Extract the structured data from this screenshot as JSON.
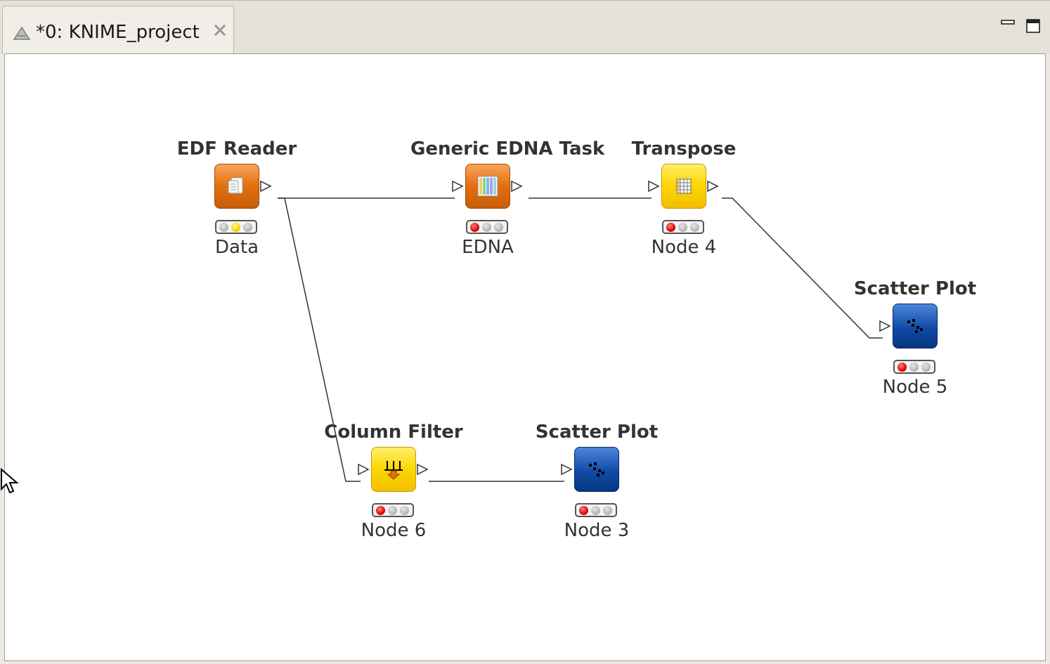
{
  "editor": {
    "tab_title": "*0: KNIME_project",
    "tab_icon": "workflow-icon",
    "close_icon": "close-icon",
    "minimize_icon": "minimize-icon",
    "maximize_icon": "maximize-icon"
  },
  "nodes": {
    "edf_reader": {
      "title": "EDF Reader",
      "label": "Data",
      "color": "#e36f0f",
      "status": "yellow",
      "icon": "file-reader-icon"
    },
    "edna_task": {
      "title": "Generic EDNA Task",
      "label": "EDNA",
      "color": "#e36f0f",
      "status": "red",
      "icon": "columns-icon"
    },
    "transpose": {
      "title": "Transpose",
      "label": "Node 4",
      "color": "#fcd600",
      "status": "red",
      "icon": "table-grid-icon"
    },
    "scatter_5": {
      "title": "Scatter Plot",
      "label": "Node 5",
      "color": "#0f4ba8",
      "status": "red",
      "icon": "scatter-plot-icon"
    },
    "column_filter": {
      "title": "Column Filter",
      "label": "Node 6",
      "color": "#fcd600",
      "status": "red",
      "icon": "column-filter-icon"
    },
    "scatter_3": {
      "title": "Scatter Plot",
      "label": "Node 3",
      "color": "#0f4ba8",
      "status": "red",
      "icon": "scatter-plot-icon"
    }
  },
  "connections": [
    {
      "from": "edf_reader",
      "to": "edna_task"
    },
    {
      "from": "edna_task",
      "to": "transpose"
    },
    {
      "from": "transpose",
      "to": "scatter_5"
    },
    {
      "from": "edf_reader",
      "to": "column_filter"
    },
    {
      "from": "column_filter",
      "to": "scatter_3"
    }
  ]
}
